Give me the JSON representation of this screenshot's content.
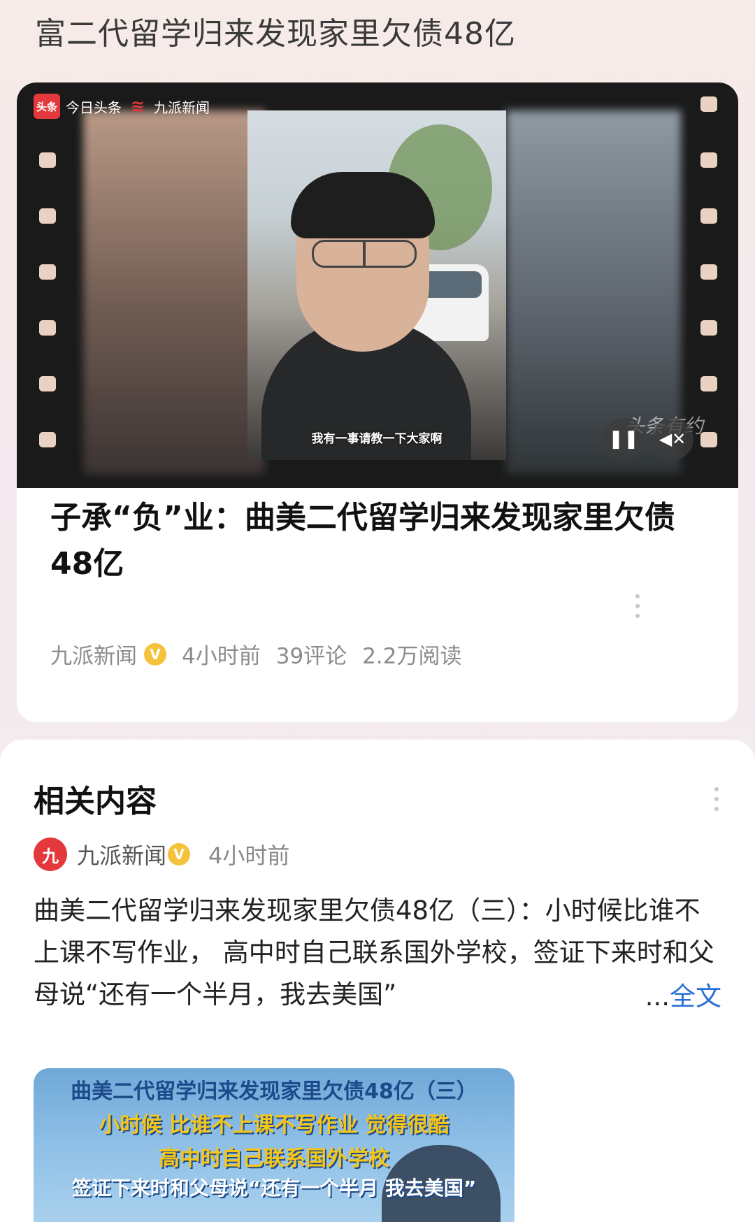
{
  "page": {
    "top_title": "富二代留学归来发现家里欠债48亿"
  },
  "video_card": {
    "logos": {
      "toutiao_badge": "头条",
      "toutiao_text": "今日头条",
      "jiupai_text": "九派新闻"
    },
    "subtitle": "我有一事请教一下大家啊",
    "watermark": "头条有约",
    "controls": {
      "pause_icon": "pause-icon",
      "mute_icon": "mute-icon"
    },
    "headline": "子承“负”业：曲美二代留学归来发现家里欠债48亿",
    "meta": {
      "source": "九派新闻",
      "verified": "V",
      "time": "4小时前",
      "comments": "39评论",
      "reads": "2.2万阅读"
    }
  },
  "related": {
    "title": "相关内容",
    "author": {
      "name": "九派新闻",
      "verified": "V",
      "time": "4小时前",
      "avatar": "九"
    },
    "text": "曲美二代留学归来发现家里欠债48亿（三）：小时候比谁不上课不写作业， 高中时自己联系国外学校，签证下来时和父母说“还有一个半月，我去美国”",
    "more_ellipsis": "...",
    "more_label": "全文",
    "thumbnail": {
      "line1": "曲美二代留学归来发现家里欠债48亿（三）",
      "line2": "小时候 比谁不上课不写作业 觉得很酷",
      "line3": "高中时自己联系国外学校",
      "line4": "签证下来时和父母说“还有一个半月 我去美国”"
    }
  }
}
